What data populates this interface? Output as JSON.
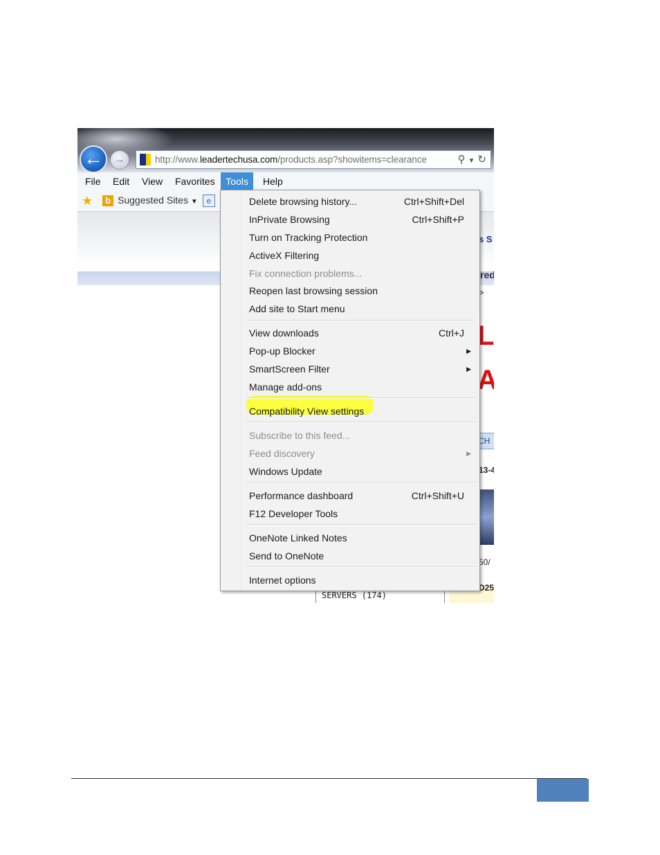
{
  "browser": {
    "address": {
      "prefix": "http://www.",
      "domain": "leadertechusa.com",
      "path": "/products.asp?showitems=clearance"
    },
    "menubar": [
      "File",
      "Edit",
      "View",
      "Favorites",
      "Tools",
      "Help"
    ],
    "active_menu": "Tools",
    "favorites_bar": {
      "suggested_sites": "Suggested Sites"
    }
  },
  "page_fragments": {
    "f1": "s S",
    "f2": "red",
    "f3": ">",
    "red1": "LE",
    "red2": "A",
    "tab": "CH",
    "code": "13-4",
    "f4": "50/",
    "f5": "D25",
    "servers": "SERVERS (174)"
  },
  "tools_menu": {
    "items": [
      {
        "label": "Delete browsing history...",
        "shortcut": "Ctrl+Shift+Del"
      },
      {
        "label": "InPrivate Browsing",
        "shortcut": "Ctrl+Shift+P"
      },
      {
        "label": "Turn on Tracking Protection",
        "shortcut": ""
      },
      {
        "label": "ActiveX Filtering",
        "shortcut": ""
      },
      {
        "label": "Fix connection problems...",
        "shortcut": "",
        "disabled": true
      },
      {
        "label": "Reopen last browsing session",
        "shortcut": ""
      },
      {
        "label": "Add site to Start menu",
        "shortcut": ""
      },
      {
        "label": "View downloads",
        "shortcut": "Ctrl+J"
      },
      {
        "label": "Pop-up Blocker",
        "submenu": true
      },
      {
        "label": "SmartScreen Filter",
        "submenu": true
      },
      {
        "label": "Manage add-ons",
        "shortcut": ""
      },
      {
        "label": "Compatibility View settings",
        "shortcut": "",
        "highlighted": true
      },
      {
        "label": "Subscribe to this feed...",
        "shortcut": "",
        "disabled": true
      },
      {
        "label": "Feed discovery",
        "submenu": true,
        "disabled": true
      },
      {
        "label": "Windows Update",
        "shortcut": ""
      },
      {
        "label": "Performance dashboard",
        "shortcut": "Ctrl+Shift+U"
      },
      {
        "label": "F12 Developer Tools",
        "shortcut": ""
      },
      {
        "label": "OneNote Linked Notes",
        "shortcut": ""
      },
      {
        "label": "Send to OneNote",
        "shortcut": ""
      },
      {
        "label": "Internet options",
        "shortcut": ""
      }
    ]
  },
  "colors": {
    "menu_active": "#3f8fd8",
    "highlight": "#fbff34",
    "footer_accent": "#4f81bd"
  }
}
